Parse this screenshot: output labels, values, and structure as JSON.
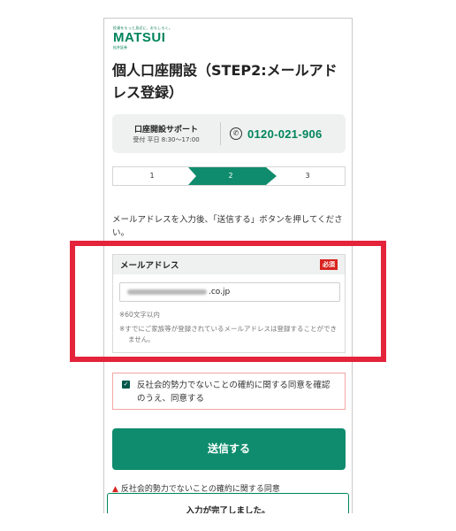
{
  "header": {
    "logo_tagline": "投資をもっと身近に、おもしろく。",
    "logo_main": "MATSUI",
    "logo_sub": "松井証券"
  },
  "page_title": "個人口座開設（STEP2:メールアドレス登録）",
  "support": {
    "title": "口座開設サポート",
    "hours": "受付 平日 8:30〜17:00",
    "phone_icon": "phone-icon",
    "phone_number": "0120-021-906"
  },
  "steps": {
    "items": [
      "1",
      "2",
      "3"
    ],
    "current": 2,
    "active_color": "#0f8c6d"
  },
  "instruction": "メールアドレスを入力後、「送信する」ボタンを押してください。",
  "email_field": {
    "label": "メールアドレス",
    "required_badge": "必須",
    "value_suffix": ".co.jp",
    "hint_length": "※60文字以内",
    "hint_family": "※すでにご家族等が登録されているメールアドレスは登録することができません。"
  },
  "consent": {
    "checked": true,
    "text": "反社会的勢力でないことの確約に関する同意を確認のうえ、同意する"
  },
  "submit_label": "送信する",
  "warning_text": "反社会的勢力でないことの確約に関する同意",
  "toast_text": "入力が完了しました。",
  "colors": {
    "brand": "#00845c",
    "button": "#0f8c6d",
    "required": "#d8231f",
    "highlight": "#e3243b"
  }
}
